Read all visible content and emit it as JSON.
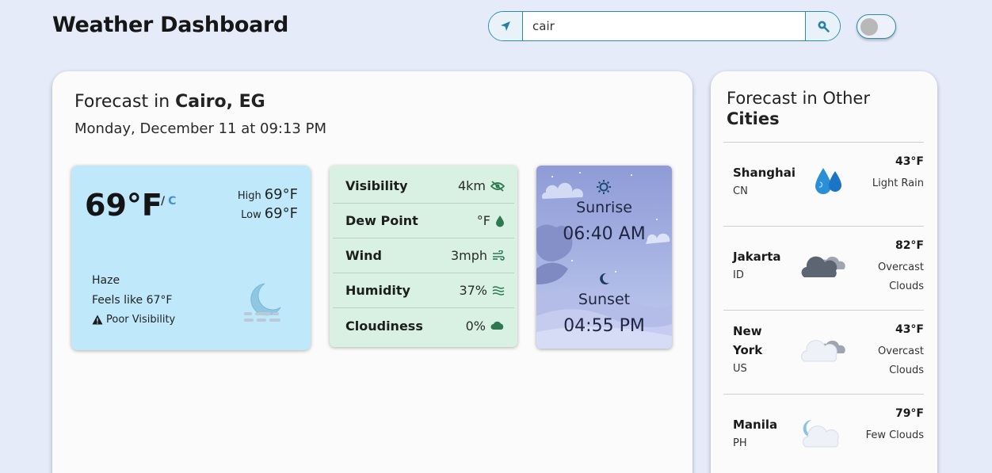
{
  "header": {
    "title": "Weather Dashboard",
    "search_value": "cair",
    "location_icon": "location-arrow-icon",
    "search_icon": "search-icon"
  },
  "main": {
    "heading_prefix": "Forecast in ",
    "city": "Cairo, EG",
    "date_time": "Monday, December 11 at 09:13 PM",
    "current": {
      "temperature": "69°F",
      "unit_separator": "/",
      "unit_alt": "C",
      "high_label": "High",
      "high_value": "69°F",
      "low_label": "Low",
      "low_value": "69°F",
      "condition": "Haze",
      "feels_like": "Feels like 67°F",
      "warning": "Poor Visibility",
      "icon": "haze-moon-icon"
    },
    "details": [
      {
        "label": "Visibility",
        "value": "4km",
        "icon": "eye-slash-icon"
      },
      {
        "label": "Dew Point",
        "value": "°F",
        "icon": "droplet-icon"
      },
      {
        "label": "Wind",
        "value": "3mph",
        "icon": "wind-icon"
      },
      {
        "label": "Humidity",
        "value": "37%",
        "icon": "water-waves-icon"
      },
      {
        "label": "Cloudiness",
        "value": "0%",
        "icon": "cloud-icon"
      }
    ],
    "sun": {
      "sunrise_label": "Sunrise",
      "sunrise_time": "06:40 AM",
      "sunset_label": "Sunset",
      "sunset_time": "04:55 PM"
    }
  },
  "side": {
    "title_line1": "Forecast in Other",
    "title_line2": "Cities",
    "cities": [
      {
        "name": "Shanghai",
        "country": "CN",
        "temp": "43°F",
        "desc": "Light Rain",
        "icon": "rain-drops-icon"
      },
      {
        "name": "Jakarta",
        "country": "ID",
        "temp": "82°F",
        "desc": "Overcast Clouds",
        "icon": "overcast-clouds-icon"
      },
      {
        "name": "New York",
        "country": "US",
        "temp": "43°F",
        "desc": "Overcast Clouds",
        "icon": "overcast-clouds-icon"
      },
      {
        "name": "Manila",
        "country": "PH",
        "temp": "79°F",
        "desc": "Few Clouds",
        "icon": "few-clouds-night-icon"
      }
    ]
  },
  "colors": {
    "background": "#e6ebfa",
    "accent": "#2a8fa6",
    "current_card": "#bfe9fb",
    "details_card": "#d8f1e2",
    "detail_icon": "#2d7a52"
  }
}
